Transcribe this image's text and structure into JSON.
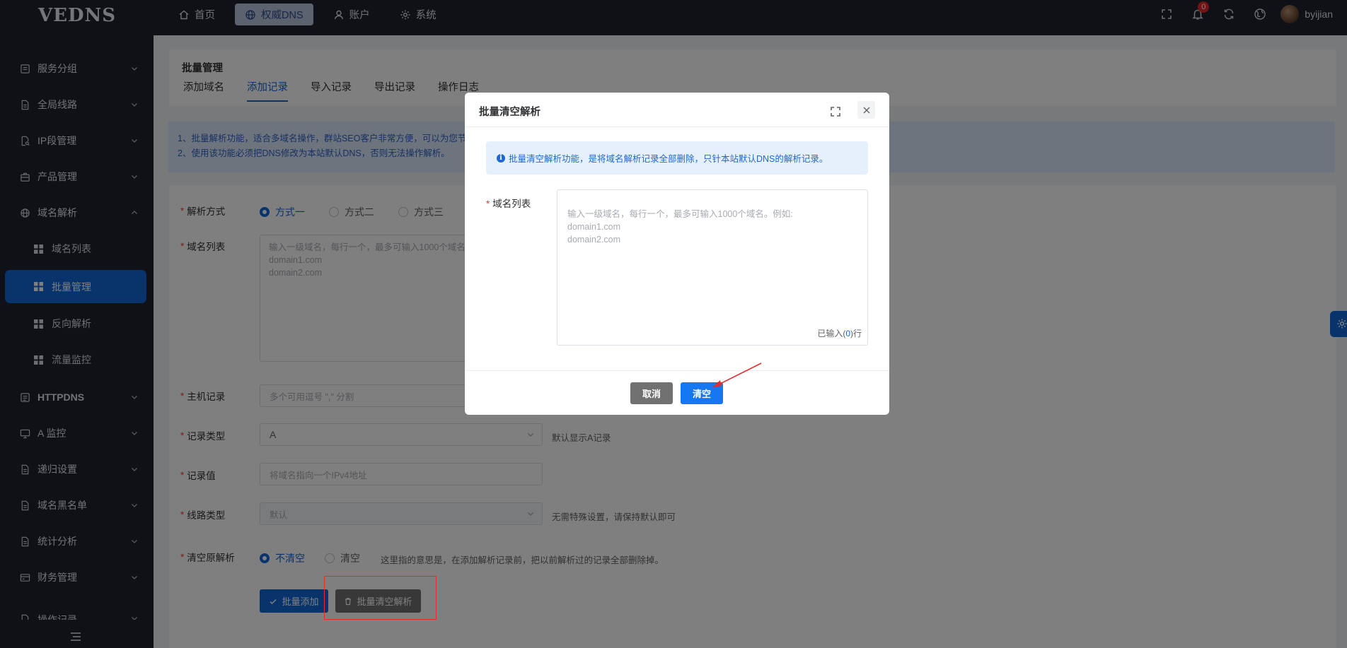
{
  "app": {
    "logo": "VEDNS"
  },
  "nav": [
    {
      "label": "首页",
      "icon": "home-icon",
      "active": false
    },
    {
      "label": "权威DNS",
      "icon": "globe-icon",
      "active": true
    },
    {
      "label": "账户",
      "icon": "user-icon",
      "active": false
    },
    {
      "label": "系统",
      "icon": "gear-icon",
      "active": false
    }
  ],
  "header": {
    "notification_count": "0",
    "username": "byijian"
  },
  "sidebar": {
    "items": [
      {
        "label": "服务分组"
      },
      {
        "label": "全局线路"
      },
      {
        "label": "IP段管理"
      },
      {
        "label": "产品管理"
      },
      {
        "label": "域名解析"
      },
      {
        "label": "HTTPDNS"
      },
      {
        "label": "A 监控"
      },
      {
        "label": "递归设置"
      },
      {
        "label": "域名黑名单"
      },
      {
        "label": "统计分析"
      },
      {
        "label": "财务管理"
      },
      {
        "label": "操作记录"
      }
    ],
    "sub_items": [
      {
        "label": "域名列表"
      },
      {
        "label": "批量管理",
        "active": true
      },
      {
        "label": "反向解析"
      },
      {
        "label": "流量监控"
      }
    ]
  },
  "page": {
    "title": "批量管理",
    "tabs": [
      {
        "label": "添加域名"
      },
      {
        "label": "添加记录",
        "active": true
      },
      {
        "label": "导入记录"
      },
      {
        "label": "导出记录"
      },
      {
        "label": "操作日志"
      }
    ],
    "notice": [
      "1、批量解析功能，适合多域名操作，群站SEO客户非常方便，可以为您节省",
      "2、使用该功能必须把DNS修改为本站默认DNS，否则无法操作解析。"
    ]
  },
  "form": {
    "method": {
      "label": "解析方式",
      "options": [
        "方式一",
        "方式二",
        "方式三"
      ],
      "selected": "方式一"
    },
    "domains": {
      "label": "域名列表",
      "placeholder": "输入一级域名，每行一个，最多可输入1000个域名。\ndomain1.com\ndomain2.com"
    },
    "host": {
      "label": "主机记录",
      "placeholder": "多个可用逗号 \",\"  分割"
    },
    "record_type": {
      "label": "记录类型",
      "value": "A",
      "hint": "默认显示A记录"
    },
    "record_value": {
      "label": "记录值",
      "placeholder": "将域名指向一个IPv4地址"
    },
    "line_type": {
      "label": "线路类型",
      "value": "默认",
      "hint": "无需特殊设置，请保持默认即可"
    },
    "clear_existing": {
      "label": "清空原解析",
      "options": [
        "不清空",
        "清空"
      ],
      "selected": "不清空",
      "hint": "这里指的意思是，在添加解析记录前，把以前解析过的记录全部删除掉。"
    },
    "buttons": {
      "batch_add": "批量添加",
      "batch_clear": "批量清空解析"
    }
  },
  "dialog": {
    "title": "批量清空解析",
    "alert": "批量清空解析功能，是将域名解析记录全部删除，只针本站默认DNS的解析记录。",
    "field_label": "域名列表",
    "placeholder": "输入一级域名，每行一个，最多可输入1000个域名。例如:\ndomain1.com\ndomain2.com",
    "count_prefix": "已输入(",
    "count_value": "0",
    "count_suffix": ")行",
    "cancel": "取消",
    "confirm": "清空"
  },
  "colors": {
    "primary": "#1366d6",
    "dark_bg": "#1e222d",
    "annotation": "#e62b2b"
  }
}
